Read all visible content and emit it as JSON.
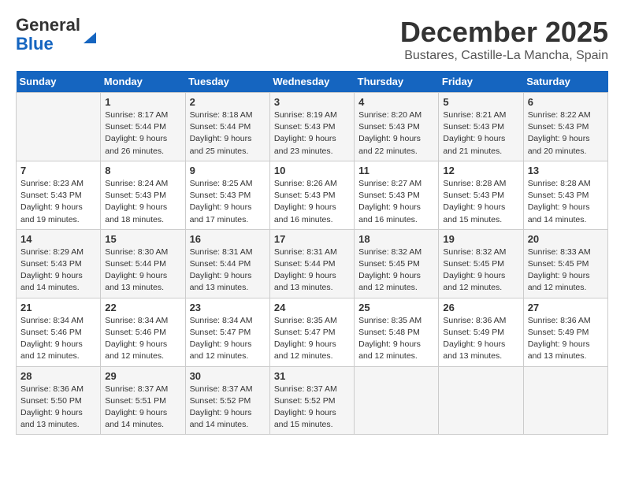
{
  "logo": {
    "line1": "General",
    "line2": "Blue"
  },
  "title": "December 2025",
  "subtitle": "Bustares, Castille-La Mancha, Spain",
  "weekdays": [
    "Sunday",
    "Monday",
    "Tuesday",
    "Wednesday",
    "Thursday",
    "Friday",
    "Saturday"
  ],
  "weeks": [
    [
      {
        "day": "",
        "info": ""
      },
      {
        "day": "1",
        "info": "Sunrise: 8:17 AM\nSunset: 5:44 PM\nDaylight: 9 hours\nand 26 minutes."
      },
      {
        "day": "2",
        "info": "Sunrise: 8:18 AM\nSunset: 5:44 PM\nDaylight: 9 hours\nand 25 minutes."
      },
      {
        "day": "3",
        "info": "Sunrise: 8:19 AM\nSunset: 5:43 PM\nDaylight: 9 hours\nand 23 minutes."
      },
      {
        "day": "4",
        "info": "Sunrise: 8:20 AM\nSunset: 5:43 PM\nDaylight: 9 hours\nand 22 minutes."
      },
      {
        "day": "5",
        "info": "Sunrise: 8:21 AM\nSunset: 5:43 PM\nDaylight: 9 hours\nand 21 minutes."
      },
      {
        "day": "6",
        "info": "Sunrise: 8:22 AM\nSunset: 5:43 PM\nDaylight: 9 hours\nand 20 minutes."
      }
    ],
    [
      {
        "day": "7",
        "info": "Sunrise: 8:23 AM\nSunset: 5:43 PM\nDaylight: 9 hours\nand 19 minutes."
      },
      {
        "day": "8",
        "info": "Sunrise: 8:24 AM\nSunset: 5:43 PM\nDaylight: 9 hours\nand 18 minutes."
      },
      {
        "day": "9",
        "info": "Sunrise: 8:25 AM\nSunset: 5:43 PM\nDaylight: 9 hours\nand 17 minutes."
      },
      {
        "day": "10",
        "info": "Sunrise: 8:26 AM\nSunset: 5:43 PM\nDaylight: 9 hours\nand 16 minutes."
      },
      {
        "day": "11",
        "info": "Sunrise: 8:27 AM\nSunset: 5:43 PM\nDaylight: 9 hours\nand 16 minutes."
      },
      {
        "day": "12",
        "info": "Sunrise: 8:28 AM\nSunset: 5:43 PM\nDaylight: 9 hours\nand 15 minutes."
      },
      {
        "day": "13",
        "info": "Sunrise: 8:28 AM\nSunset: 5:43 PM\nDaylight: 9 hours\nand 14 minutes."
      }
    ],
    [
      {
        "day": "14",
        "info": "Sunrise: 8:29 AM\nSunset: 5:43 PM\nDaylight: 9 hours\nand 14 minutes."
      },
      {
        "day": "15",
        "info": "Sunrise: 8:30 AM\nSunset: 5:44 PM\nDaylight: 9 hours\nand 13 minutes."
      },
      {
        "day": "16",
        "info": "Sunrise: 8:31 AM\nSunset: 5:44 PM\nDaylight: 9 hours\nand 13 minutes."
      },
      {
        "day": "17",
        "info": "Sunrise: 8:31 AM\nSunset: 5:44 PM\nDaylight: 9 hours\nand 13 minutes."
      },
      {
        "day": "18",
        "info": "Sunrise: 8:32 AM\nSunset: 5:45 PM\nDaylight: 9 hours\nand 12 minutes."
      },
      {
        "day": "19",
        "info": "Sunrise: 8:32 AM\nSunset: 5:45 PM\nDaylight: 9 hours\nand 12 minutes."
      },
      {
        "day": "20",
        "info": "Sunrise: 8:33 AM\nSunset: 5:45 PM\nDaylight: 9 hours\nand 12 minutes."
      }
    ],
    [
      {
        "day": "21",
        "info": "Sunrise: 8:34 AM\nSunset: 5:46 PM\nDaylight: 9 hours\nand 12 minutes."
      },
      {
        "day": "22",
        "info": "Sunrise: 8:34 AM\nSunset: 5:46 PM\nDaylight: 9 hours\nand 12 minutes."
      },
      {
        "day": "23",
        "info": "Sunrise: 8:34 AM\nSunset: 5:47 PM\nDaylight: 9 hours\nand 12 minutes."
      },
      {
        "day": "24",
        "info": "Sunrise: 8:35 AM\nSunset: 5:47 PM\nDaylight: 9 hours\nand 12 minutes."
      },
      {
        "day": "25",
        "info": "Sunrise: 8:35 AM\nSunset: 5:48 PM\nDaylight: 9 hours\nand 12 minutes."
      },
      {
        "day": "26",
        "info": "Sunrise: 8:36 AM\nSunset: 5:49 PM\nDaylight: 9 hours\nand 13 minutes."
      },
      {
        "day": "27",
        "info": "Sunrise: 8:36 AM\nSunset: 5:49 PM\nDaylight: 9 hours\nand 13 minutes."
      }
    ],
    [
      {
        "day": "28",
        "info": "Sunrise: 8:36 AM\nSunset: 5:50 PM\nDaylight: 9 hours\nand 13 minutes."
      },
      {
        "day": "29",
        "info": "Sunrise: 8:37 AM\nSunset: 5:51 PM\nDaylight: 9 hours\nand 14 minutes."
      },
      {
        "day": "30",
        "info": "Sunrise: 8:37 AM\nSunset: 5:52 PM\nDaylight: 9 hours\nand 14 minutes."
      },
      {
        "day": "31",
        "info": "Sunrise: 8:37 AM\nSunset: 5:52 PM\nDaylight: 9 hours\nand 15 minutes."
      },
      {
        "day": "",
        "info": ""
      },
      {
        "day": "",
        "info": ""
      },
      {
        "day": "",
        "info": ""
      }
    ]
  ]
}
